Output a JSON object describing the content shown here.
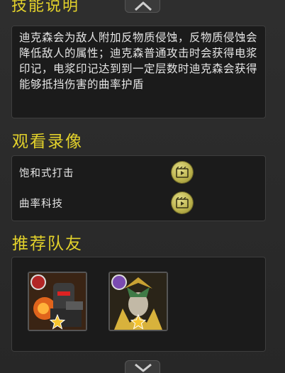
{
  "panel": {
    "cut_title": "技能说明",
    "description": "迪克森会为敌人附加反物质侵蚀，反物质侵蚀会降低敌人的属性；迪克森普通攻击时会获得电浆印记，电浆印记达到到一定层数时迪克森会获得能够抵挡伤害的曲率护盾"
  },
  "videos": {
    "title": "观看录像",
    "items": [
      {
        "label": "饱和式打击"
      },
      {
        "label": "曲率科技"
      }
    ]
  },
  "team": {
    "title": "推荐队友",
    "heroes": [
      {
        "faction_icon": "crimson-gear-emblem-icon",
        "stars": 1
      },
      {
        "faction_icon": "violet-crest-emblem-icon",
        "stars": 1
      }
    ]
  },
  "colors": {
    "accent_title": "#e3d22b",
    "play_button": "#c9c056",
    "panel_bg": "#1b1b1b"
  }
}
